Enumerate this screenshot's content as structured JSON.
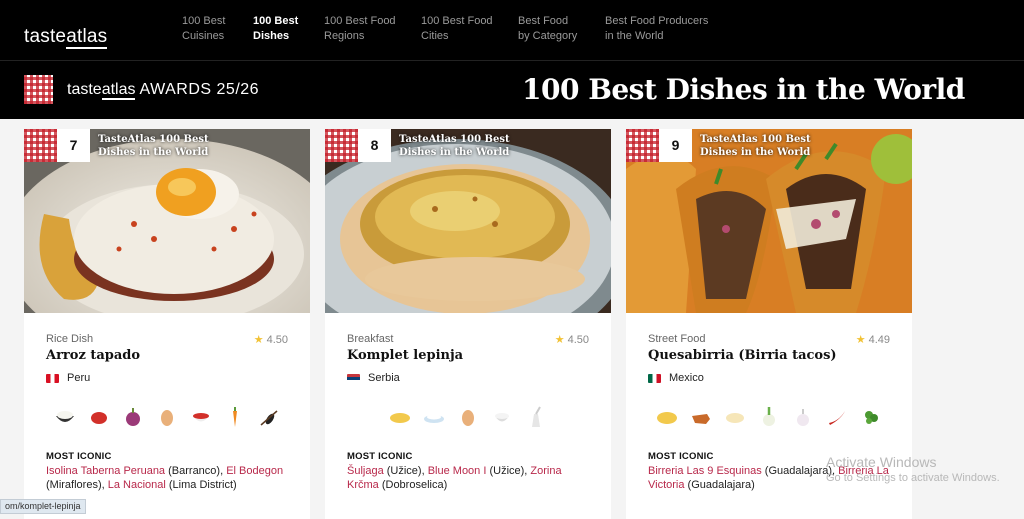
{
  "nav": {
    "logo": {
      "part1": "taste",
      "part2": "atlas"
    },
    "items": [
      {
        "label": "100 Best\nCuisines",
        "active": false
      },
      {
        "label": "100 Best\nDishes",
        "active": true
      },
      {
        "label": "100 Best Food\nRegions",
        "active": false
      },
      {
        "label": "100 Best Food\nCities",
        "active": false
      },
      {
        "label": "Best Food\nby Category",
        "active": false
      },
      {
        "label": "Best Food Producers\nin the World",
        "active": false
      }
    ]
  },
  "banner": {
    "brand_part1": "taste",
    "brand_part2": "atlas",
    "awards_label": " AWARDS 25/26",
    "heading": "100 Best Dishes in the World"
  },
  "cards": [
    {
      "rank": "7",
      "rank_label": "TasteAtlas 100 Best Dishes in the World",
      "category": "Rice Dish",
      "rating": "4.50",
      "name": "Arroz tapado",
      "country": "Peru",
      "ingredient_icons": [
        "rice-icon",
        "tomato-icon",
        "onion-icon",
        "egg-icon",
        "tomato-sauce-icon",
        "carrot-icon",
        "olive-icon"
      ],
      "most_iconic_label": "MOST ICONIC",
      "places": [
        {
          "name": "Isolina Taberna Peruana",
          "loc": " (Barranco), "
        },
        {
          "name": "El Bodegon",
          "loc": " (Miraflores), "
        },
        {
          "name": "La Nacional",
          "loc": " (Lima District)"
        }
      ]
    },
    {
      "rank": "8",
      "rank_label": "TasteAtlas 100 Best Dishes in the World",
      "category": "Breakfast",
      "rating": "4.50",
      "name": "Komplet lepinja",
      "country": "Serbia",
      "ingredient_icons": [
        "bread-icon",
        "kaymak-icon",
        "egg-icon",
        "lard-icon",
        "salt-icon"
      ],
      "most_iconic_label": "MOST ICONIC",
      "places": [
        {
          "name": "Šuljaga",
          "loc": " (Užice), "
        },
        {
          "name": "Blue Moon I",
          "loc": " (Užice), "
        },
        {
          "name": "Zorina Krčma",
          "loc": " (Dobroselica)"
        }
      ]
    },
    {
      "rank": "9",
      "rank_label": "TasteAtlas 100 Best Dishes in the World",
      "category": "Street Food",
      "rating": "4.49",
      "name": "Quesabirria (Birria tacos)",
      "country": "Mexico",
      "ingredient_icons": [
        "tortilla-icon",
        "beef-icon",
        "cheese-icon",
        "onion-icon",
        "garlic-icon",
        "chili-icon",
        "cilantro-icon"
      ],
      "most_iconic_label": "MOST ICONIC",
      "places": [
        {
          "name": "Birreria Las 9 Esquinas",
          "loc": " (Guadalajara), "
        },
        {
          "name": "Birreria La Victoria",
          "loc": " (Guadalajara)"
        }
      ]
    }
  ],
  "status_url": "om/komplet-lepinja",
  "watermark": {
    "line1": "Activate Windows",
    "line2": "Go to Settings to activate Windows."
  }
}
